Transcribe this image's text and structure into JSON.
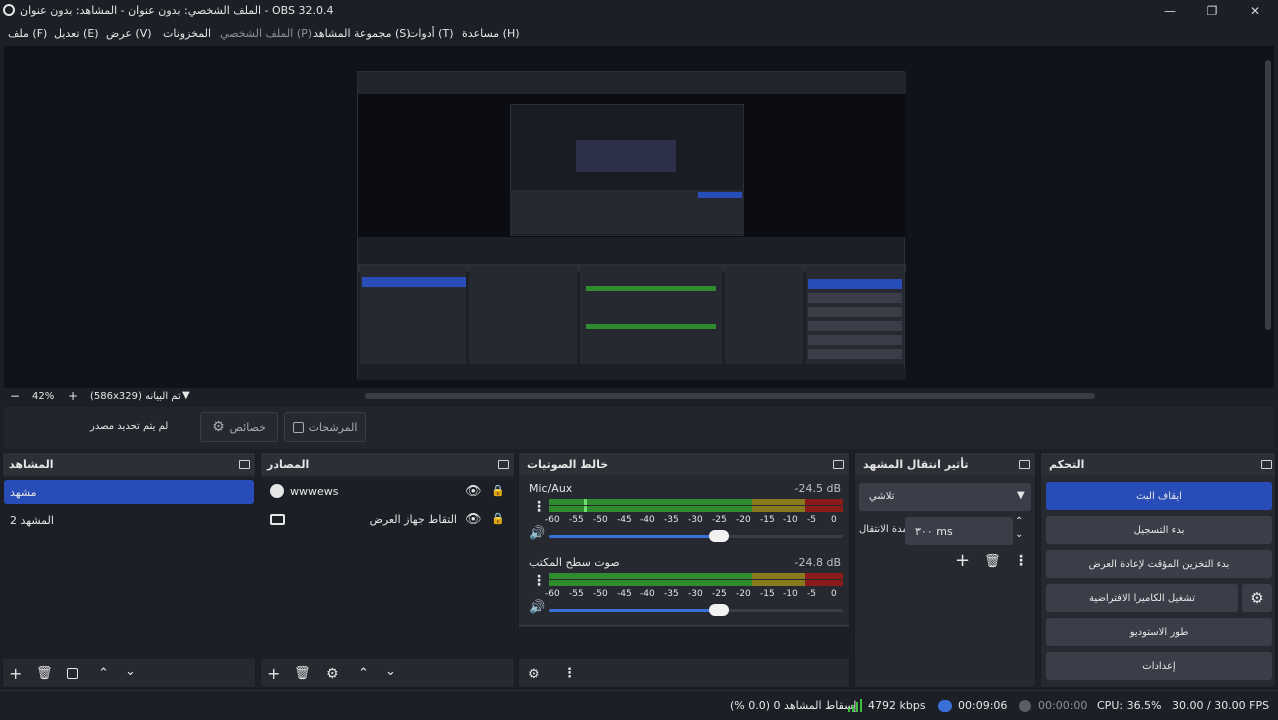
{
  "window": {
    "title": "OBS 32.0.4 - الملف الشخصي: بدون عنوان - المشاهد: بدون عنوان",
    "minimize": "—",
    "restore": "❐",
    "close": "✕"
  },
  "menu": [
    "ملف (F)",
    "تعديل (E)",
    "عرض (V)",
    "المخزونات",
    "الملف الشخصي (P)",
    "مجموعة المشاهد (S)",
    "أدوات (T)",
    "مساعدة (H)"
  ],
  "preview": {
    "zoom": "42%",
    "status": "(586x329) تم البيانه"
  },
  "context": {
    "no_source": "لم يتم تحديد مصدر",
    "properties": "خصائص",
    "filters": "المرشحات"
  },
  "scenes": {
    "title": "المشاهد",
    "items": [
      "مشهد",
      "المشهد 2"
    ]
  },
  "sources": {
    "title": "المصادر",
    "items": [
      {
        "name": "wwwews",
        "icon": "browser-icon"
      },
      {
        "name": "التقاط جهاز العرض",
        "icon": "display-icon"
      }
    ]
  },
  "mixer": {
    "title": "خالط الصوتيات",
    "channels": [
      {
        "name": "Mic/Aux",
        "db": "-24.5 dB",
        "level": 0.12,
        "volume": 0.55
      },
      {
        "name": "صوت سطح المكتب",
        "db": "-24.8 dB",
        "level": 0.0,
        "volume": 0.55
      }
    ],
    "ticks": [
      "-60",
      "-55",
      "-50",
      "-45",
      "-40",
      "-35",
      "-30",
      "-25",
      "-20",
      "-15",
      "-10",
      "-5",
      "0"
    ]
  },
  "transitions": {
    "title": "تأثير انتقال المشهد",
    "selected": "تلاشي",
    "duration_label": "مدة الانتقال",
    "duration": "٣٠٠ ms"
  },
  "controls": {
    "title": "التحكم",
    "buttons": [
      "ايقاف البث",
      "بدء التسجيل",
      "بدء التخزين المؤقت لإعادة العرض",
      "تشغيل الكاميرا الافتراضية",
      "طور الاستوديو",
      "إعدادات"
    ]
  },
  "statusbar": {
    "dropped": "إسقاط المشاهد 0 (0.0 %)",
    "bitrate": "4792 kbps",
    "stream_time": "00:09:06",
    "rec_time": "00:00:00",
    "cpu": "CPU: 36.5%",
    "fps": "30.00 / 30.00 FPS"
  },
  "colors": {
    "accent": "#284cb8",
    "meter_green": "#2e8b2e",
    "meter_yellow": "#8a7a1e",
    "meter_red": "#8b1a1a",
    "bitrate_bars": "#3fbf3f"
  }
}
